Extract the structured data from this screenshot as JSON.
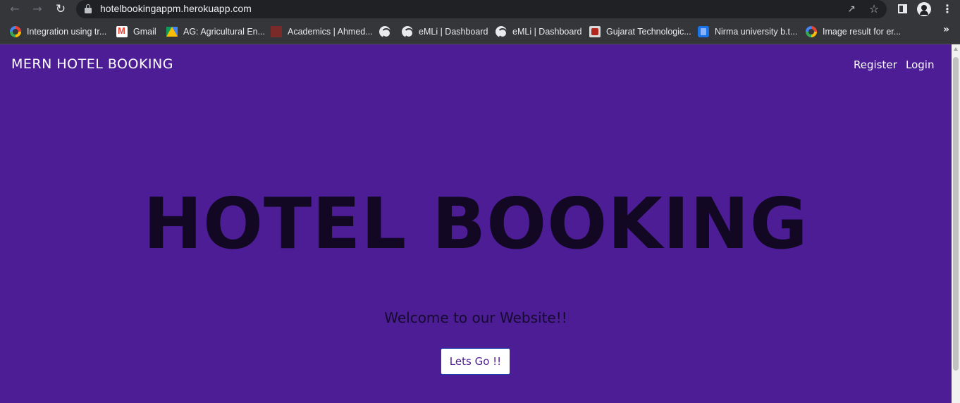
{
  "browser": {
    "url": "hotelbookingappm.herokuapp.com",
    "bookmarks": [
      {
        "label": "Integration using tr...",
        "icon": "google-icon"
      },
      {
        "label": "Gmail",
        "icon": "gmail-icon"
      },
      {
        "label": "AG: Agricultural En...",
        "icon": "drive-icon"
      },
      {
        "label": "Academics | Ahmed...",
        "icon": "site-icon"
      },
      {
        "label": "",
        "icon": "globe-icon"
      },
      {
        "label": "eMLi | Dashboard",
        "icon": "globe-icon"
      },
      {
        "label": "eMLi | Dashboard",
        "icon": "globe-icon"
      },
      {
        "label": "Gujarat Technologic...",
        "icon": "gtu-icon"
      },
      {
        "label": "Nirma university b.t...",
        "icon": "nirma-icon"
      },
      {
        "label": "Image result for er...",
        "icon": "google-icon"
      }
    ],
    "more_label": "»"
  },
  "page": {
    "brand": "MERN HOTEL BOOKING",
    "nav": {
      "register": "Register",
      "login": "Login"
    },
    "hero_title": "HOTEL BOOKING",
    "welcome": "Welcome to our Website!!",
    "cta_label": "Lets Go !!",
    "background_color": "#4c1d95"
  }
}
